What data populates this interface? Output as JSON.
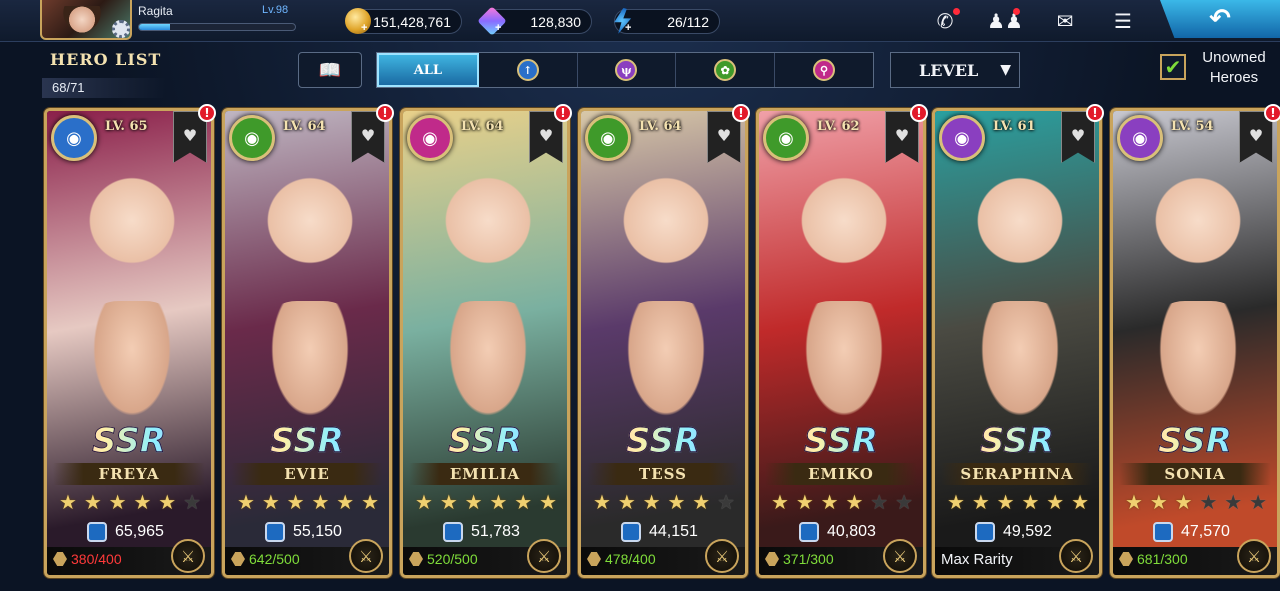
{
  "player": {
    "name": "Ragita",
    "level": "Lv.98",
    "xp_fraction": 0.2
  },
  "resources": [
    {
      "name": "gold",
      "value": "151,428,761",
      "icon": "coin-icon"
    },
    {
      "name": "crystals",
      "value": "128,830",
      "icon": "crystal-icon"
    },
    {
      "name": "energy",
      "value": "26/112",
      "icon": "energy-icon"
    }
  ],
  "header": {
    "title": "HERO LIST",
    "count": "68/71"
  },
  "tabs": [
    {
      "label": "ALL",
      "active": true
    },
    {
      "label": "",
      "icon": "sword-element-icon",
      "color": "#2a6fc9"
    },
    {
      "label": "",
      "icon": "trident-element-icon",
      "color": "#8a3fc0"
    },
    {
      "label": "",
      "icon": "nature-element-icon",
      "color": "#3f9a2a"
    },
    {
      "label": "",
      "icon": "magic-element-icon",
      "color": "#c02a8a"
    }
  ],
  "sort": {
    "label": "LEVEL"
  },
  "unowned": {
    "label_line1": "Unowned",
    "label_line2": "Heroes",
    "checked": true
  },
  "heroes": [
    {
      "name": "FREYA",
      "level": "LV. 65",
      "rarity": "SSR",
      "stars": 5,
      "power": "65,965",
      "shards": "380/400",
      "shard_status": "red",
      "element_color": "#2a6fc9",
      "element_icon": "sword-element-icon",
      "art_colors": [
        "#8a1f4a",
        "#e6c9c2",
        "#2a1a2a"
      ]
    },
    {
      "name": "EVIE",
      "level": "LV. 64",
      "rarity": "SSR",
      "stars": 6,
      "power": "55,150",
      "shards": "642/500",
      "shard_status": "green",
      "element_color": "#3f9a2a",
      "element_icon": "nature-element-icon",
      "art_colors": [
        "#bfb6c2",
        "#6a2a4a",
        "#2a2a38"
      ]
    },
    {
      "name": "EMILIA",
      "level": "LV. 64",
      "rarity": "SSR",
      "stars": 6,
      "power": "51,783",
      "shards": "520/500",
      "shard_status": "green",
      "element_color": "#c02a8a",
      "element_icon": "magic-element-icon",
      "art_colors": [
        "#e8d08a",
        "#7ab0a0",
        "#2a3a30"
      ]
    },
    {
      "name": "TESS",
      "level": "LV. 64",
      "rarity": "SSR",
      "stars": 5,
      "power": "44,151",
      "shards": "478/400",
      "shard_status": "green",
      "element_color": "#3f9a2a",
      "element_icon": "nature-element-icon",
      "art_colors": [
        "#d8c8a8",
        "#5a3a6a",
        "#2a2a2a"
      ]
    },
    {
      "name": "EMIKO",
      "level": "LV. 62",
      "rarity": "SSR",
      "stars": 4,
      "power": "40,803",
      "shards": "371/300",
      "shard_status": "green",
      "element_color": "#3f9a2a",
      "element_icon": "nature-element-icon",
      "art_colors": [
        "#f0a0a8",
        "#c02a2a",
        "#3a1a1a"
      ]
    },
    {
      "name": "SERAPHINA",
      "level": "LV. 61",
      "rarity": "SSR",
      "stars": 6,
      "power": "49,592",
      "shards": "Max Rarity",
      "shard_status": "max",
      "element_color": "#8a3fc0",
      "element_icon": "trident-element-icon",
      "art_colors": [
        "#2aa0a0",
        "#4a4a42",
        "#1a1a1a"
      ]
    },
    {
      "name": "SONIA",
      "level": "LV. 54",
      "rarity": "SSR",
      "stars": 3,
      "power": "47,570",
      "shards": "681/300",
      "shard_status": "green",
      "element_color": "#8a3fc0",
      "element_icon": "trident-element-icon",
      "art_colors": [
        "#c8c8d0",
        "#2a2a2a",
        "#c04a2a"
      ]
    }
  ]
}
